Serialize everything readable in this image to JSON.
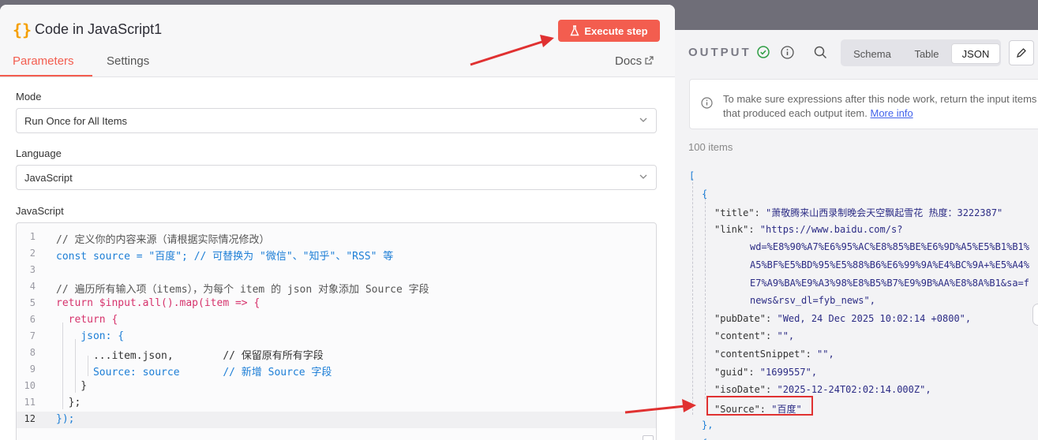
{
  "node": {
    "icon": "{}",
    "title": "Code in JavaScript1",
    "execute_label": "Execute step"
  },
  "tabs": [
    {
      "label": "Parameters",
      "active": true
    },
    {
      "label": "Settings",
      "active": false
    }
  ],
  "docs_label": "Docs",
  "fields": {
    "mode": {
      "label": "Mode",
      "value": "Run Once for All Items"
    },
    "language": {
      "label": "Language",
      "value": "JavaScript"
    },
    "code_label": "JavaScript"
  },
  "code_lines": [
    {
      "n": "1",
      "text": "// 定义你的内容来源（请根据实际情况修改）"
    },
    {
      "n": "2",
      "text": "const source = \"百度\"; // 可替换为 \"微信\"、\"知乎\"、\"RSS\" 等"
    },
    {
      "n": "3",
      "text": ""
    },
    {
      "n": "4",
      "text": "// 遍历所有输入项（items），为每个 item 的 json 对象添加 Source 字段"
    },
    {
      "n": "5",
      "text": "return $input.all().map(item => {"
    },
    {
      "n": "6",
      "text": "  return {"
    },
    {
      "n": "7",
      "text": "    json: {"
    },
    {
      "n": "8",
      "text": "      ...item.json,        // 保留原有所有字段"
    },
    {
      "n": "9",
      "text": "      Source: source       // 新增 Source 字段"
    },
    {
      "n": "10",
      "text": "    }"
    },
    {
      "n": "11",
      "text": "  };"
    },
    {
      "n": "12",
      "text": "});"
    }
  ],
  "output": {
    "title": "OUTPUT",
    "views": [
      {
        "label": "Schema",
        "active": false
      },
      {
        "label": "Table",
        "active": false
      },
      {
        "label": "JSON",
        "active": true
      }
    ],
    "hint_text": "To make sure expressions after this node work, return the input items that produced each output item.",
    "hint_link": "More info",
    "count": "100 items",
    "json_lines": [
      {
        "k": "",
        "v": "[",
        "indent": 0
      },
      {
        "k": "",
        "v": "{",
        "indent": 1
      },
      {
        "k": "\"title\": ",
        "v": "\"萧敬腾来山西录制晚会天空飘起雪花 热度：3222387\"",
        "indent": 2
      },
      {
        "k": "\"link\": ",
        "v": "\"https://www.baidu.com/s?",
        "indent": 2
      },
      {
        "k": "",
        "v": "wd=%E8%90%A7%E6%95%AC%E8%85%BE%E6%9D%A5%E5%B1%B1%",
        "indent": 3
      },
      {
        "k": "",
        "v": "A5%BF%E5%BD%95%E5%88%B6%E6%99%9A%E4%BC%9A+%E5%A4%",
        "indent": 3
      },
      {
        "k": "",
        "v": "E7%A9%BA%E9%A3%98%E8%B5%B7%E9%9B%AA%E8%8A%B1&sa=f",
        "indent": 3
      },
      {
        "k": "",
        "v": "news&rsv_dl=fyb_news\",",
        "indent": 3
      },
      {
        "k": "\"pubDate\": ",
        "v": "\"Wed, 24 Dec 2025 10:02:14 +0800\",",
        "indent": 2
      },
      {
        "k": "\"content\": ",
        "v": "\"\",",
        "indent": 2
      },
      {
        "k": "\"contentSnippet\": ",
        "v": "\"\",",
        "indent": 2
      },
      {
        "k": "\"guid\": ",
        "v": "\"1699557\",",
        "indent": 2
      },
      {
        "k": "\"isoDate\": ",
        "v": "\"2025-12-24T02:02:14.000Z\",",
        "indent": 2
      },
      {
        "k": "\"Source\": ",
        "v": "\"百度\"",
        "indent": 2
      },
      {
        "k": "",
        "v": "},",
        "indent": 1
      },
      {
        "k": "",
        "v": "{",
        "indent": 1
      }
    ]
  },
  "colors": {
    "accent": "#f35d4f",
    "success": "#2f9e44",
    "link": "#4263eb",
    "annotation": "#e03131"
  }
}
